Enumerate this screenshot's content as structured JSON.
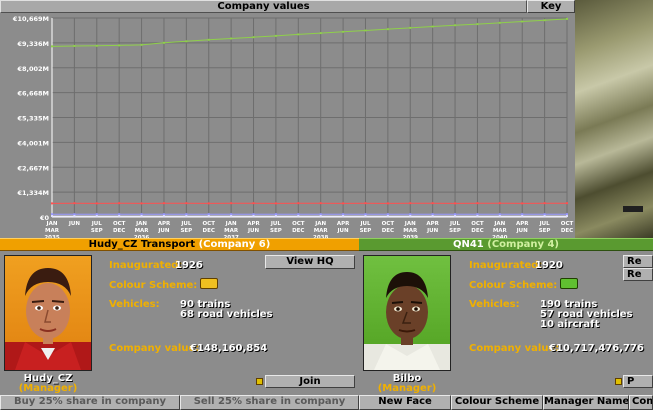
{
  "graph": {
    "title": "Company values",
    "key_label": "Key",
    "y_labels": [
      "€10,669M",
      "€9,336M",
      "€8,002M",
      "€6,668M",
      "€5,335M",
      "€4,001M",
      "€2,667M",
      "€1,334M",
      "€0"
    ],
    "x_labels": [
      [
        "JAN",
        "MAR",
        "2035"
      ],
      [
        "JUN",
        ""
      ],
      [
        "JUL",
        "SEP"
      ],
      [
        "OCT",
        "DEC"
      ],
      [
        "JAN",
        "MAR",
        "2036"
      ],
      [
        "APR",
        "JUN"
      ],
      [
        "JUL",
        "SEP"
      ],
      [
        "OCT",
        "DEC"
      ],
      [
        "JAN",
        "MAR",
        "2037"
      ],
      [
        "APR",
        "JUN"
      ],
      [
        "JUL",
        "SEP"
      ],
      [
        "OCT",
        "DEC"
      ],
      [
        "JAN",
        "MAR",
        "2038"
      ],
      [
        "APR",
        "JUN"
      ],
      [
        "JUL",
        "SEP"
      ],
      [
        "OCT",
        "DEC"
      ],
      [
        "JAN",
        "MAR",
        "2039"
      ],
      [
        "APR",
        "JUN"
      ],
      [
        "JUL",
        "SEP"
      ],
      [
        "OCT",
        "DEC"
      ],
      [
        "JAN",
        "MAR",
        "2040"
      ],
      [
        "APR",
        "JUN"
      ],
      [
        "JUL",
        "SEP"
      ],
      [
        "OCT",
        "DEC"
      ]
    ]
  },
  "chart_data": {
    "type": "line",
    "title": "Company values",
    "ylim": [
      0,
      10669
    ],
    "y_unit": "€M",
    "x": [
      "Jan-Mar 2035",
      "Apr-Jun 2035",
      "Jul-Sep 2035",
      "Oct-Dec 2035",
      "Jan-Mar 2036",
      "Apr-Jun 2036",
      "Jul-Sep 2036",
      "Oct-Dec 2036",
      "Jan-Mar 2037",
      "Apr-Jun 2037",
      "Jul-Sep 2037",
      "Oct-Dec 2037",
      "Jan-Mar 2038",
      "Apr-Jun 2038",
      "Jul-Sep 2038",
      "Oct-Dec 2038",
      "Jan-Mar 2039",
      "Apr-Jun 2039",
      "Jul-Sep 2039",
      "Oct-Dec 2039",
      "Jan-Mar 2040",
      "Apr-Jun 2040",
      "Jul-Sep 2040",
      "Oct-Dec 2040"
    ],
    "series": [
      {
        "color": "#8fd04a",
        "values": [
          9150,
          9170,
          9180,
          9200,
          9230,
          9340,
          9420,
          9500,
          9570,
          9640,
          9710,
          9790,
          9860,
          9930,
          10000,
          10070,
          10140,
          10210,
          10280,
          10340,
          10410,
          10480,
          10550,
          10620
        ]
      },
      {
        "color": "#ff5050",
        "values": [
          730,
          740,
          730,
          740,
          730,
          740,
          740,
          730,
          740,
          740,
          730,
          740,
          740,
          730,
          740,
          730,
          740,
          740,
          730,
          740,
          740,
          730,
          740,
          740
        ]
      },
      {
        "color": "#9898ff",
        "values": [
          150,
          148,
          150,
          149,
          150,
          148,
          150,
          150,
          148,
          149,
          150,
          150,
          148,
          150,
          149,
          150,
          148,
          150,
          150,
          149,
          148,
          150,
          149,
          150
        ]
      },
      {
        "color": "#e0e0ff",
        "values": [
          50,
          50,
          50,
          50,
          50,
          50,
          50,
          50,
          50,
          50,
          50,
          50,
          50,
          50,
          50,
          50,
          50,
          50,
          50,
          50,
          50,
          50,
          50,
          50
        ]
      }
    ]
  },
  "left_company": {
    "header_name": "Hudy_CZ Transport",
    "header_num": "(Company 6)",
    "header_color": "#f0a000",
    "inaugurated_label": "Inaugurated:",
    "inaugurated_value": "1926",
    "colour_label": "Colour Scheme:",
    "vehicles_label": "Vehicles:",
    "vehicles": [
      "90 trains",
      "68 road vehicles"
    ],
    "value_label": "Company value:",
    "value": "€148,160,854",
    "manager_name": "Hudy_CZ",
    "manager_title": "(Manager)",
    "view_hq": "View HQ",
    "join": "Join",
    "buy_share": "Buy 25% share in company",
    "sell_share": "Sell 25% share in company"
  },
  "right_company": {
    "header_name": "QN41",
    "header_num": "(Company 4)",
    "header_color": "#60a030",
    "inaugurated_label": "Inaugurated:",
    "inaugurated_value": "1920",
    "colour_label": "Colour Scheme:",
    "vehicles_label": "Vehicles:",
    "vehicles": [
      "190 trains",
      "57 road vehicles",
      "10 aircraft"
    ],
    "value_label": "Company value:",
    "value": "€10,717,476,776",
    "manager_name": "Bilbo",
    "manager_title": "(Manager)",
    "btn_re1": "Re",
    "btn_re2": "Re",
    "btn_p": "P",
    "new_face": "New Face",
    "colour_scheme": "Colour Scheme",
    "manager_name_btn": "Manager Name",
    "company_btn": "Com"
  }
}
